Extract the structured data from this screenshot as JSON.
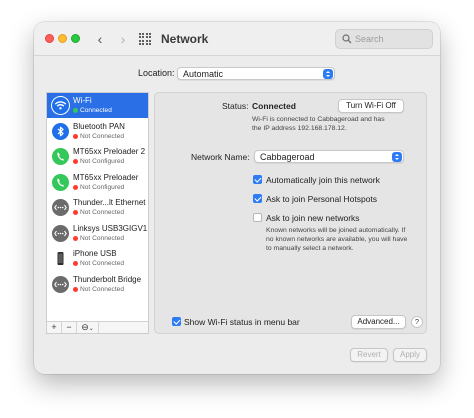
{
  "window": {
    "title": "Network",
    "search_placeholder": "Search"
  },
  "location": {
    "label": "Location:",
    "value": "Automatic"
  },
  "services": [
    {
      "name": "Wi-Fi",
      "status": "Connected",
      "status_color": "#34c759",
      "icon": "wifi-icon",
      "icon_color": "#1f6fea",
      "selected": true
    },
    {
      "name": "Bluetooth PAN",
      "status": "Not Connected",
      "status_color": "#ff3b30",
      "icon": "bluetooth-icon",
      "icon_color": "#1f6fea",
      "selected": false
    },
    {
      "name": "MT65xx Preloader 2",
      "status": "Not Configured",
      "status_color": "#ff3b30",
      "icon": "phone-icon",
      "icon_color": "#34c759",
      "selected": false
    },
    {
      "name": "MT65xx Preloader",
      "status": "Not Configured",
      "status_color": "#ff3b30",
      "icon": "phone-icon",
      "icon_color": "#34c759",
      "selected": false
    },
    {
      "name": "Thunder...lt Ethernet",
      "status": "Not Connected",
      "status_color": "#ff3b30",
      "icon": "ethernet-icon",
      "icon_color": "#6b6b6b",
      "selected": false
    },
    {
      "name": "Linksys USB3GIGV1",
      "status": "Not Connected",
      "status_color": "#ff3b30",
      "icon": "ethernet-icon",
      "icon_color": "#6b6b6b",
      "selected": false
    },
    {
      "name": "iPhone USB",
      "status": "Not Connected",
      "status_color": "#ff3b30",
      "icon": "iphone-icon",
      "icon_color": "#4a4a4a",
      "selected": false
    },
    {
      "name": "Thunderbolt Bridge",
      "status": "Not Connected",
      "status_color": "#ff3b30",
      "icon": "ethernet-icon",
      "icon_color": "#6b6b6b",
      "selected": false
    }
  ],
  "sidebar_footer": {
    "add": "+",
    "remove": "−",
    "actions": "⊖",
    "actions_chevron": "⌄"
  },
  "detail": {
    "status_label": "Status:",
    "status_value": "Connected",
    "turn_off_button": "Turn Wi-Fi Off",
    "status_description_1": "Wi-Fi is connected to Cabbageroad and has",
    "status_description_2": "the IP address 192.168.178.12.",
    "network_name_label": "Network Name:",
    "network_name_value": "Cabbageroad",
    "auto_join_label": "Automatically join this network",
    "auto_join_checked": true,
    "hotspots_label": "Ask to join Personal Hotspots",
    "hotspots_checked": true,
    "new_networks_label": "Ask to join new networks",
    "new_networks_checked": false,
    "note_1": "Known networks will be joined automatically. If",
    "note_2": "no known networks are available, you will have",
    "note_3": "to manually select a network.",
    "menu_bar_label": "Show Wi-Fi status in menu bar",
    "menu_bar_checked": true,
    "advanced_button": "Advanced...",
    "help_button": "?"
  },
  "footer": {
    "revert": "Revert",
    "apply": "Apply"
  },
  "accent_color": "#2d7cf6",
  "selection_color": "#2a6fe6"
}
